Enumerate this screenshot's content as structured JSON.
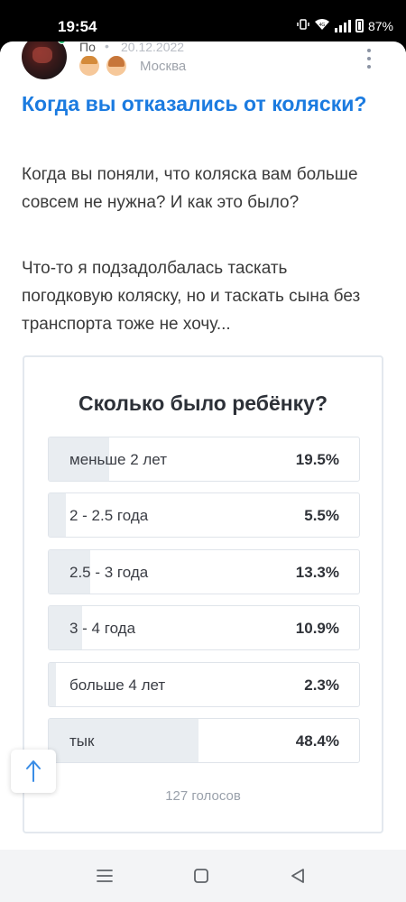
{
  "status_bar": {
    "time": "19:54",
    "battery": "87%",
    "network": "4G"
  },
  "post": {
    "author": "По",
    "date": "20.12.2022",
    "separator": "•",
    "city": "Москва",
    "title": "Когда вы отказались от коляски?",
    "question": "Когда вы поняли, что коляска вам больше совсем не нужна? И как это было?",
    "body": "Что-то я подзадолбалась таскать погодковую коляску, но и таскать сына без транспорта тоже не хочу..."
  },
  "poll": {
    "title": "Сколько было ребёнку?",
    "options": [
      {
        "label": "меньше 2 лет",
        "percent": "19.5%",
        "value": 19.5
      },
      {
        "label": "2 - 2.5 года",
        "percent": "5.5%",
        "value": 5.5
      },
      {
        "label": "2.5 - 3 года",
        "percent": "13.3%",
        "value": 13.3
      },
      {
        "label": "3 - 4 года",
        "percent": "10.9%",
        "value": 10.9
      },
      {
        "label": "больше 4 лет",
        "percent": "2.3%",
        "value": 2.3
      },
      {
        "label": "тык",
        "percent": "48.4%",
        "value": 48.4
      }
    ],
    "votes": "127 голосов"
  },
  "icons": {
    "status": [
      "vibrate-icon",
      "wifi-icon",
      "signal-icon",
      "battery-icon"
    ],
    "author": [
      "avatar",
      "online-dot",
      "boy-icon",
      "girl-icon",
      "more-vertical-icon"
    ],
    "controls": [
      "arrow-up-icon",
      "recent-apps-icon",
      "home-icon",
      "back-icon"
    ]
  },
  "colors": {
    "title_blue": "#1b7be0",
    "poll_fill": "#e9edf1",
    "online": "#27c274",
    "status_bar": "#000000"
  }
}
